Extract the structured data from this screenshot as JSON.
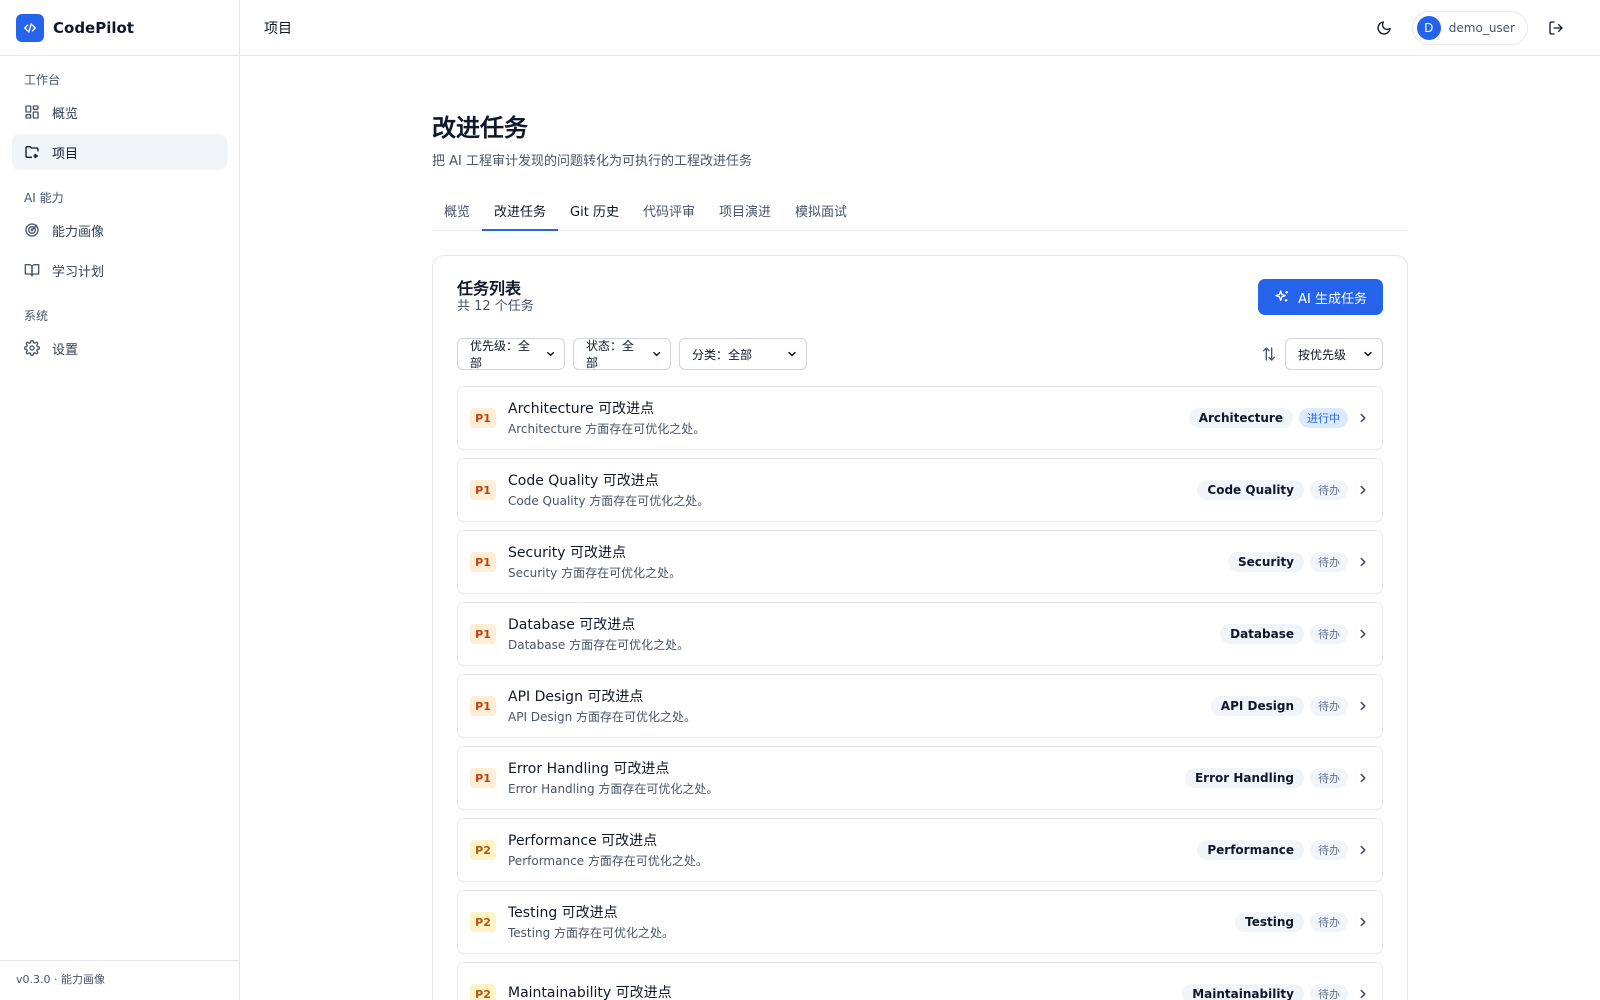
{
  "brand": {
    "name": "CodePilot"
  },
  "sidebar": {
    "sections": [
      {
        "title": "工作台",
        "items": [
          {
            "label": "概览",
            "icon": "grid-icon",
            "active": false
          },
          {
            "label": "项目",
            "icon": "folder-icon",
            "active": true
          }
        ]
      },
      {
        "title": "AI 能力",
        "items": [
          {
            "label": "能力画像",
            "icon": "radar-icon",
            "active": false
          },
          {
            "label": "学习计划",
            "icon": "book-icon",
            "active": false
          }
        ]
      },
      {
        "title": "系统",
        "items": [
          {
            "label": "设置",
            "icon": "gear-icon",
            "active": false
          }
        ]
      }
    ],
    "version": "v0.3.0 · 能力画像"
  },
  "header": {
    "title": "项目",
    "user": {
      "initial": "D",
      "name": "demo_user"
    }
  },
  "main": {
    "title": "改进任务",
    "subtitle": "把 AI 工程审计发现的问题转化为可执行的工程改进任务",
    "tabs": [
      {
        "label": "概览",
        "active": false
      },
      {
        "label": "改进任务",
        "active": true
      },
      {
        "label": "Git 历史",
        "active": false
      },
      {
        "label": "代码评审",
        "active": false
      },
      {
        "label": "项目演进",
        "active": false
      },
      {
        "label": "模拟面试",
        "active": false
      }
    ]
  },
  "card": {
    "title": "任务列表",
    "count": "共 12 个任务",
    "generate_label": "AI 生成任务",
    "filters": {
      "priority": "优先级：全部",
      "status": "状态：全部",
      "category": "分类：全部",
      "sort": "按优先级"
    }
  },
  "tasks": [
    {
      "priority": "P1",
      "title": "Architecture 可改进点",
      "desc": "Architecture 方面存在可优化之处。",
      "category": "Architecture",
      "status": "进行中",
      "status_type": "progress"
    },
    {
      "priority": "P1",
      "title": "Code Quality 可改进点",
      "desc": "Code Quality 方面存在可优化之处。",
      "category": "Code Quality",
      "status": "待办",
      "status_type": "todo"
    },
    {
      "priority": "P1",
      "title": "Security 可改进点",
      "desc": "Security 方面存在可优化之处。",
      "category": "Security",
      "status": "待办",
      "status_type": "todo"
    },
    {
      "priority": "P1",
      "title": "Database 可改进点",
      "desc": "Database 方面存在可优化之处。",
      "category": "Database",
      "status": "待办",
      "status_type": "todo"
    },
    {
      "priority": "P1",
      "title": "API Design 可改进点",
      "desc": "API Design 方面存在可优化之处。",
      "category": "API Design",
      "status": "待办",
      "status_type": "todo"
    },
    {
      "priority": "P1",
      "title": "Error Handling 可改进点",
      "desc": "Error Handling 方面存在可优化之处。",
      "category": "Error Handling",
      "status": "待办",
      "status_type": "todo"
    },
    {
      "priority": "P2",
      "title": "Performance 可改进点",
      "desc": "Performance 方面存在可优化之处。",
      "category": "Performance",
      "status": "待办",
      "status_type": "todo"
    },
    {
      "priority": "P2",
      "title": "Testing 可改进点",
      "desc": "Testing 方面存在可优化之处。",
      "category": "Testing",
      "status": "待办",
      "status_type": "todo"
    },
    {
      "priority": "P2",
      "title": "Maintainability 可改进点",
      "desc": "",
      "category": "Maintainability",
      "status": "待办",
      "status_type": "todo"
    }
  ],
  "colors": {
    "accent": "#2563eb",
    "p1_bg": "#ffedd5",
    "p1_fg": "#c2410c",
    "p2_bg": "#fef3c7",
    "p2_fg": "#b45309"
  }
}
